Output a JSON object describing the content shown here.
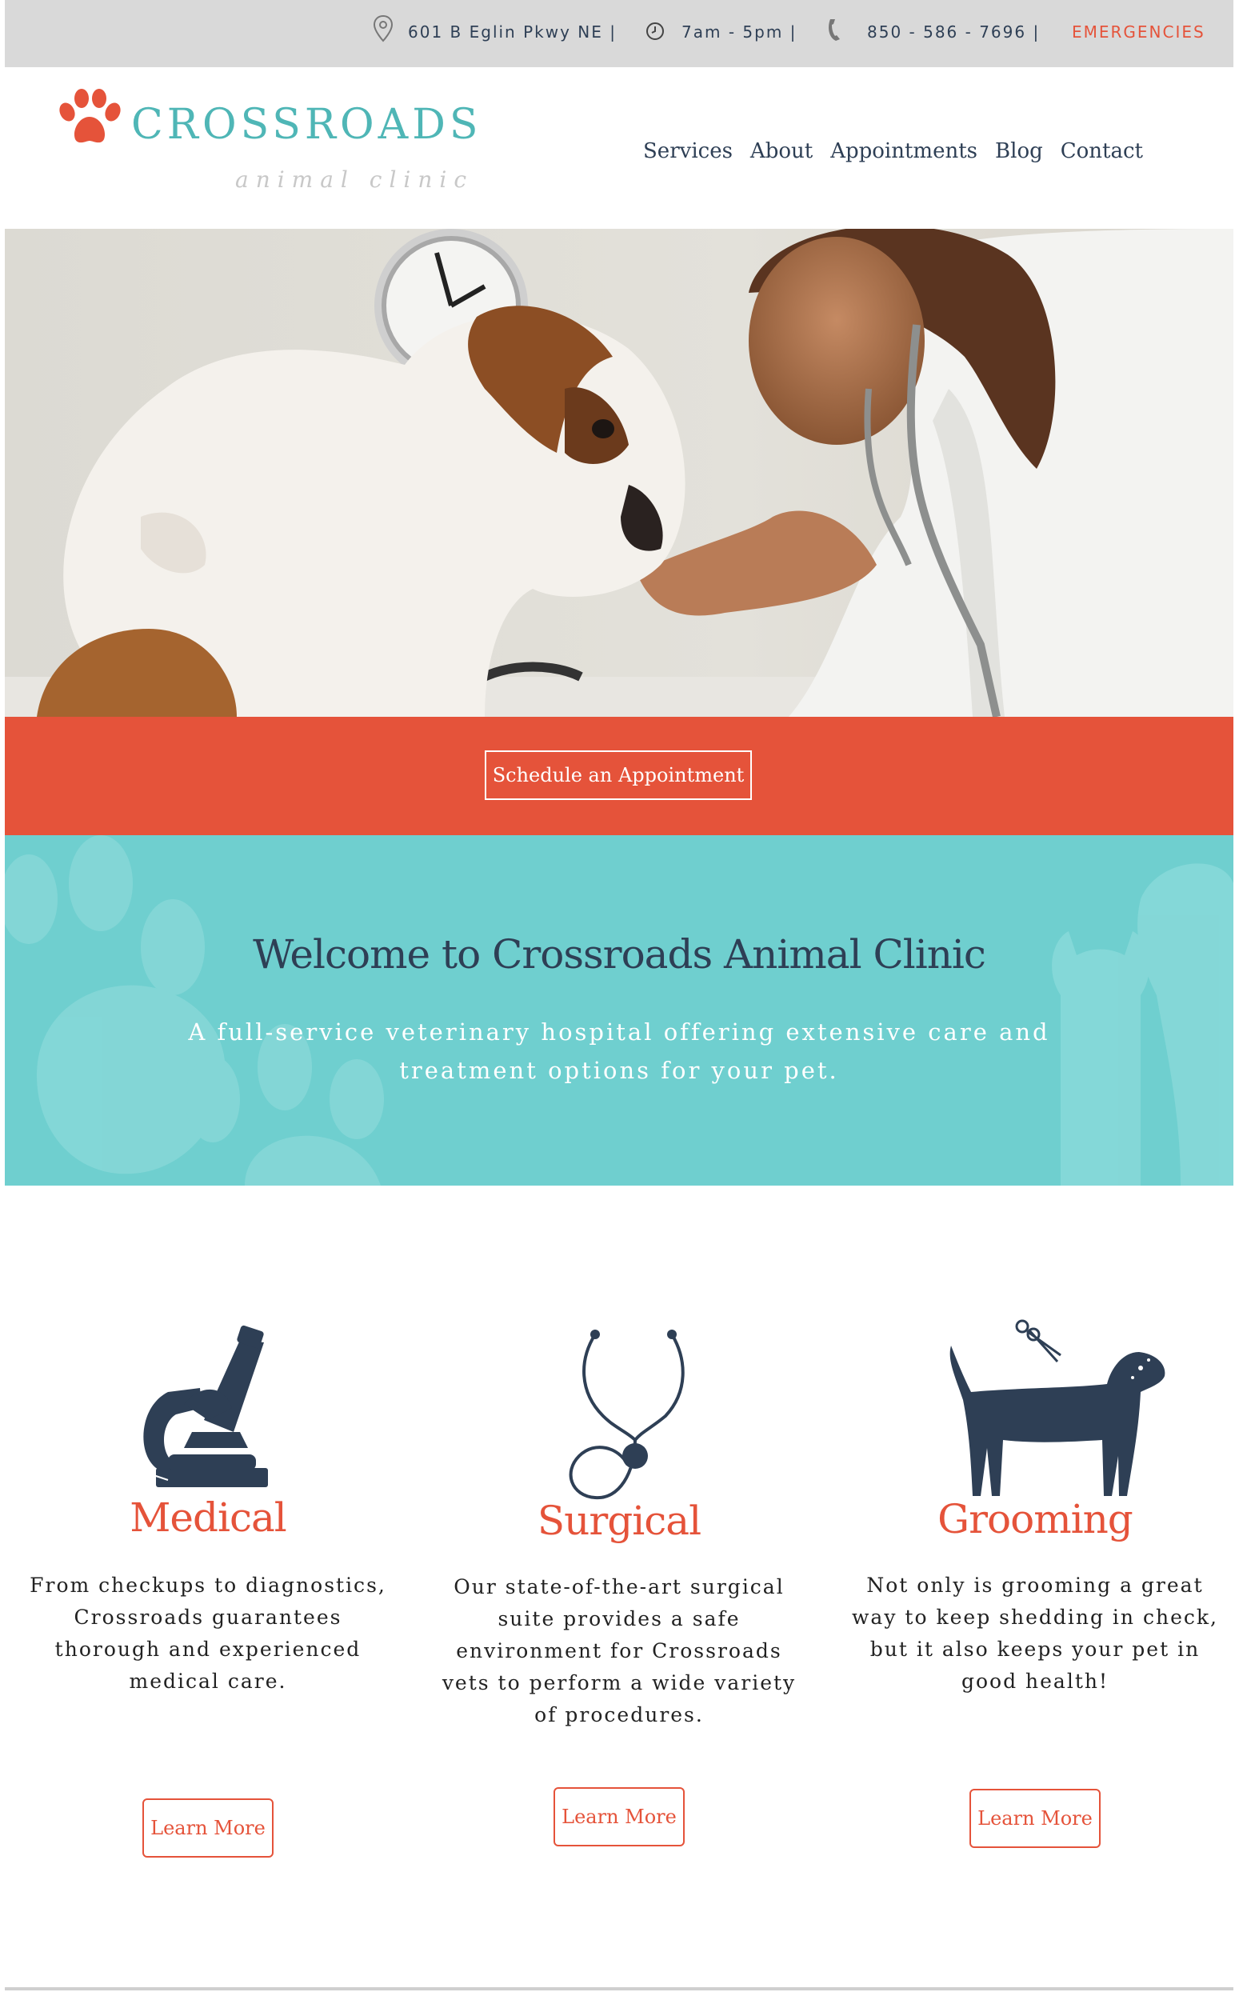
{
  "topbar": {
    "address": "601 B Eglin Pkwy NE |",
    "hours": "7am - 5pm |",
    "phone": "850 - 586 - 7696 |",
    "emergencies": "EMERGENCIES",
    "icons": [
      "map-pin-icon",
      "clock-icon",
      "phone-icon"
    ]
  },
  "logo": {
    "name": "CROSSROADS",
    "tagline": "animal clinic",
    "icon": "paw-icon"
  },
  "nav": {
    "items": [
      "Services",
      "About",
      "Appointments",
      "Blog",
      "Contact"
    ]
  },
  "cta": {
    "label": "Schedule an Appointment"
  },
  "welcome": {
    "title": "Welcome to Crossroads Animal Clinic",
    "subtitle": "A full-service veterinary hospital offering extensive care and treatment options for your pet."
  },
  "services": [
    {
      "title": "Medical",
      "icon": "microscope-icon",
      "text": "From checkups to diagnostics, Crossroads guarantees thorough and experienced medical care.",
      "button": "Learn More"
    },
    {
      "title": "Surgical",
      "icon": "stethoscope-icon",
      "text": "Our state-of-the-art surgical suite provides a safe environment for Crossroads vets to perform a wide variety of procedures.",
      "button": "Learn More"
    },
    {
      "title": "Grooming",
      "icon": "dog-scissors-icon",
      "text": "Not only is grooming a great way to keep shedding in check, but it also keeps your pet in good health!",
      "button": "Learn More"
    }
  ],
  "colors": {
    "accent": "#e5533a",
    "teal": "#6fcfcf",
    "navy": "#2e3f55",
    "logo_teal": "#4fb6b6"
  }
}
